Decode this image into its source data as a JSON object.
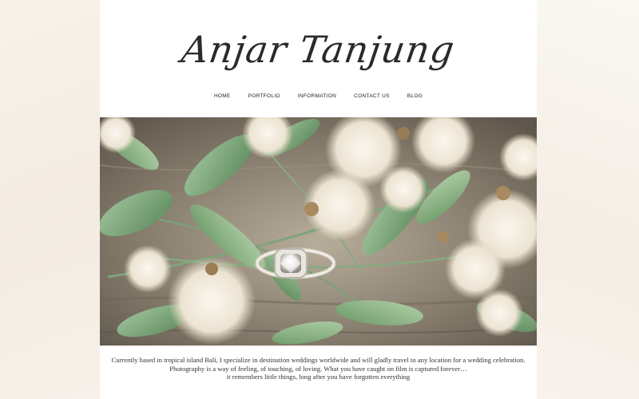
{
  "brand": {
    "logo_text": "Anjar Tanjung"
  },
  "nav": {
    "items": [
      {
        "label": "HOME"
      },
      {
        "label": "PORTFOLIO"
      },
      {
        "label": "INFORMATION"
      },
      {
        "label": "CONTACT US"
      },
      {
        "label": "BLOG"
      }
    ]
  },
  "hero": {
    "image_subject": "engagement-ring-photo"
  },
  "intro": {
    "line1": "Currently based in tropical island Bali, I specialize in destination weddings worldwide and will gladly travel to any location for a wedding celebration.",
    "line2": "Photography is a way of feeling, of touching, of loving. What you have caught on film is captured forever…",
    "line3": "it remembers little things, long after you have forgotten everything"
  },
  "colors": {
    "page_background": "#ffffff",
    "outer_background": "#f6f1ea",
    "text": "#222222"
  }
}
